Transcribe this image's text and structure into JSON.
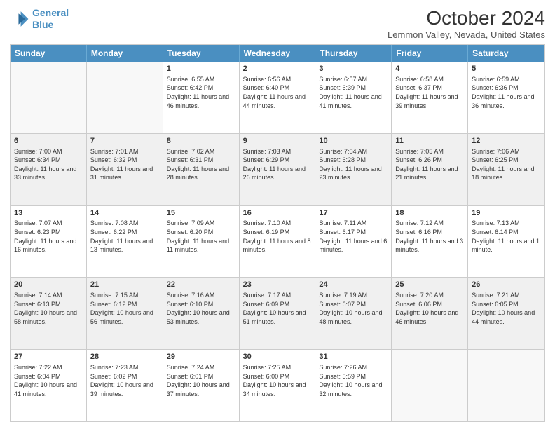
{
  "header": {
    "logo_line1": "General",
    "logo_line2": "Blue",
    "title": "October 2024",
    "subtitle": "Lemmon Valley, Nevada, United States"
  },
  "days": [
    "Sunday",
    "Monday",
    "Tuesday",
    "Wednesday",
    "Thursday",
    "Friday",
    "Saturday"
  ],
  "rows": [
    [
      {
        "num": "",
        "info": "",
        "empty": true
      },
      {
        "num": "",
        "info": "",
        "empty": true
      },
      {
        "num": "1",
        "info": "Sunrise: 6:55 AM\nSunset: 6:42 PM\nDaylight: 11 hours and 46 minutes.",
        "empty": false
      },
      {
        "num": "2",
        "info": "Sunrise: 6:56 AM\nSunset: 6:40 PM\nDaylight: 11 hours and 44 minutes.",
        "empty": false
      },
      {
        "num": "3",
        "info": "Sunrise: 6:57 AM\nSunset: 6:39 PM\nDaylight: 11 hours and 41 minutes.",
        "empty": false
      },
      {
        "num": "4",
        "info": "Sunrise: 6:58 AM\nSunset: 6:37 PM\nDaylight: 11 hours and 39 minutes.",
        "empty": false
      },
      {
        "num": "5",
        "info": "Sunrise: 6:59 AM\nSunset: 6:36 PM\nDaylight: 11 hours and 36 minutes.",
        "empty": false
      }
    ],
    [
      {
        "num": "6",
        "info": "Sunrise: 7:00 AM\nSunset: 6:34 PM\nDaylight: 11 hours and 33 minutes.",
        "empty": false
      },
      {
        "num": "7",
        "info": "Sunrise: 7:01 AM\nSunset: 6:32 PM\nDaylight: 11 hours and 31 minutes.",
        "empty": false
      },
      {
        "num": "8",
        "info": "Sunrise: 7:02 AM\nSunset: 6:31 PM\nDaylight: 11 hours and 28 minutes.",
        "empty": false
      },
      {
        "num": "9",
        "info": "Sunrise: 7:03 AM\nSunset: 6:29 PM\nDaylight: 11 hours and 26 minutes.",
        "empty": false
      },
      {
        "num": "10",
        "info": "Sunrise: 7:04 AM\nSunset: 6:28 PM\nDaylight: 11 hours and 23 minutes.",
        "empty": false
      },
      {
        "num": "11",
        "info": "Sunrise: 7:05 AM\nSunset: 6:26 PM\nDaylight: 11 hours and 21 minutes.",
        "empty": false
      },
      {
        "num": "12",
        "info": "Sunrise: 7:06 AM\nSunset: 6:25 PM\nDaylight: 11 hours and 18 minutes.",
        "empty": false
      }
    ],
    [
      {
        "num": "13",
        "info": "Sunrise: 7:07 AM\nSunset: 6:23 PM\nDaylight: 11 hours and 16 minutes.",
        "empty": false
      },
      {
        "num": "14",
        "info": "Sunrise: 7:08 AM\nSunset: 6:22 PM\nDaylight: 11 hours and 13 minutes.",
        "empty": false
      },
      {
        "num": "15",
        "info": "Sunrise: 7:09 AM\nSunset: 6:20 PM\nDaylight: 11 hours and 11 minutes.",
        "empty": false
      },
      {
        "num": "16",
        "info": "Sunrise: 7:10 AM\nSunset: 6:19 PM\nDaylight: 11 hours and 8 minutes.",
        "empty": false
      },
      {
        "num": "17",
        "info": "Sunrise: 7:11 AM\nSunset: 6:17 PM\nDaylight: 11 hours and 6 minutes.",
        "empty": false
      },
      {
        "num": "18",
        "info": "Sunrise: 7:12 AM\nSunset: 6:16 PM\nDaylight: 11 hours and 3 minutes.",
        "empty": false
      },
      {
        "num": "19",
        "info": "Sunrise: 7:13 AM\nSunset: 6:14 PM\nDaylight: 11 hours and 1 minute.",
        "empty": false
      }
    ],
    [
      {
        "num": "20",
        "info": "Sunrise: 7:14 AM\nSunset: 6:13 PM\nDaylight: 10 hours and 58 minutes.",
        "empty": false
      },
      {
        "num": "21",
        "info": "Sunrise: 7:15 AM\nSunset: 6:12 PM\nDaylight: 10 hours and 56 minutes.",
        "empty": false
      },
      {
        "num": "22",
        "info": "Sunrise: 7:16 AM\nSunset: 6:10 PM\nDaylight: 10 hours and 53 minutes.",
        "empty": false
      },
      {
        "num": "23",
        "info": "Sunrise: 7:17 AM\nSunset: 6:09 PM\nDaylight: 10 hours and 51 minutes.",
        "empty": false
      },
      {
        "num": "24",
        "info": "Sunrise: 7:19 AM\nSunset: 6:07 PM\nDaylight: 10 hours and 48 minutes.",
        "empty": false
      },
      {
        "num": "25",
        "info": "Sunrise: 7:20 AM\nSunset: 6:06 PM\nDaylight: 10 hours and 46 minutes.",
        "empty": false
      },
      {
        "num": "26",
        "info": "Sunrise: 7:21 AM\nSunset: 6:05 PM\nDaylight: 10 hours and 44 minutes.",
        "empty": false
      }
    ],
    [
      {
        "num": "27",
        "info": "Sunrise: 7:22 AM\nSunset: 6:04 PM\nDaylight: 10 hours and 41 minutes.",
        "empty": false
      },
      {
        "num": "28",
        "info": "Sunrise: 7:23 AM\nSunset: 6:02 PM\nDaylight: 10 hours and 39 minutes.",
        "empty": false
      },
      {
        "num": "29",
        "info": "Sunrise: 7:24 AM\nSunset: 6:01 PM\nDaylight: 10 hours and 37 minutes.",
        "empty": false
      },
      {
        "num": "30",
        "info": "Sunrise: 7:25 AM\nSunset: 6:00 PM\nDaylight: 10 hours and 34 minutes.",
        "empty": false
      },
      {
        "num": "31",
        "info": "Sunrise: 7:26 AM\nSunset: 5:59 PM\nDaylight: 10 hours and 32 minutes.",
        "empty": false
      },
      {
        "num": "",
        "info": "",
        "empty": true
      },
      {
        "num": "",
        "info": "",
        "empty": true
      }
    ]
  ]
}
